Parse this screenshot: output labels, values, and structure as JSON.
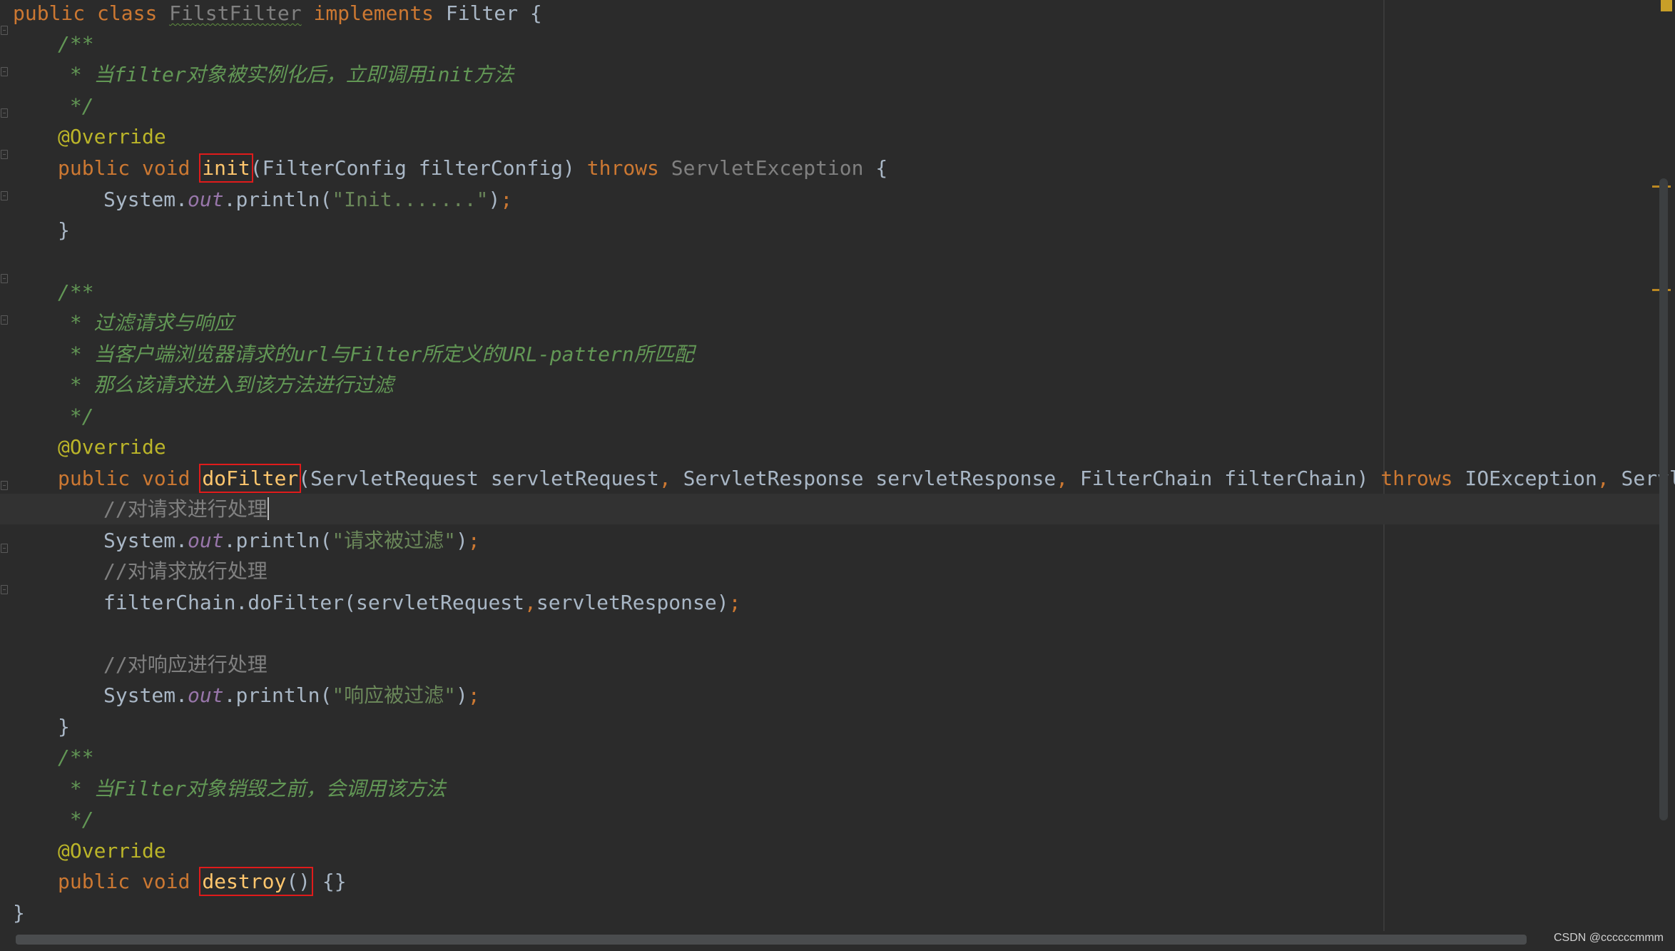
{
  "code": {
    "class_kw1": "public",
    "class_kw2": "class",
    "class_name": "FilstFilter",
    "implements_kw": "implements",
    "interface_name": "Filter",
    "open_brace": "{",
    "doc1_open": "/**",
    "doc1_text": " * 当filter对象被实例化后，立即调用init方法",
    "doc1_close": " */",
    "override": "@Override",
    "kw_public": "public",
    "kw_void": "void",
    "init_name": "init",
    "init_params": "(FilterConfig filterConfig) ",
    "throws_kw": "throws",
    "servlet_exception": "ServletException",
    "init_open": " {",
    "println_prefix": "System.",
    "out_field": "out",
    "println_call": ".println(",
    "init_str": "\"Init.......\"",
    "println_close": ")",
    "semicolon": ";",
    "close_brace": "}",
    "doc2_open": "/**",
    "doc2_line1": " * 过滤请求与响应",
    "doc2_line2": " * 当客户端浏览器请求的url与Filter所定义的URL-pattern所匹配",
    "doc2_line3": " * 那么该请求进入到该方法进行过滤",
    "doc2_close": " */",
    "dofilter_name": "doFilter",
    "dofilter_p1": "(ServletRequest servletRequest",
    "comma": ",",
    "dofilter_p2": " ServletResponse servletResponse",
    "dofilter_p3": " FilterChain filterChain) ",
    "ioexception": " IOException",
    "servlet_exception_cut": " ServletExcep",
    "comment1": "//对请求进行处理",
    "str_filtered": "\"请求被过滤\"",
    "comment2": "//对请求放行处理",
    "chain_call_a": "filterChain.doFilter(servletRequest",
    "chain_call_b": "servletResponse)",
    "comment3": "//对响应进行处理",
    "str_response": "\"响应被过滤\"",
    "doc3_open": "/**",
    "doc3_text": " * 当Filter对象销毁之前，会调用该方法",
    "doc3_close": " */",
    "destroy_name": "destroy",
    "destroy_parens": "()",
    "destroy_body": " {}"
  },
  "watermark": "CSDN @ccccccmmm",
  "colors": {
    "background": "#2b2b2b",
    "keyword": "#cc7832",
    "method": "#ffc66d",
    "annotation": "#bbb529",
    "string": "#6a8759",
    "javadoc": "#629755",
    "comment": "#808080",
    "static_field": "#9876aa",
    "highlight_box": "#e01b1b"
  }
}
